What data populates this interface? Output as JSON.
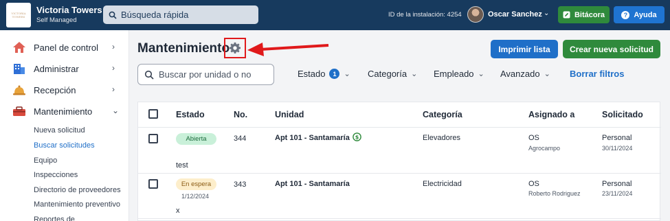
{
  "header": {
    "logo_text": "VICTORIA TOWERS",
    "brand_name": "Victoria Towers",
    "brand_sub": "Self Managed",
    "search_placeholder": "Búsqueda rápida",
    "installation_id": "ID de la instalación: 4254",
    "user_name": "Oscar Sanchez",
    "bitacora_label": "Bitácora",
    "ayuda_label": "Ayuda"
  },
  "sidebar": {
    "items": [
      {
        "label": "Panel de control",
        "chev": "›"
      },
      {
        "label": "Administrar",
        "chev": "›"
      },
      {
        "label": "Recepción",
        "chev": "›"
      },
      {
        "label": "Mantenimiento",
        "chev": "⌄"
      }
    ],
    "subitems": [
      {
        "label": "Nueva solicitud"
      },
      {
        "label": "Buscar solicitudes"
      },
      {
        "label": "Equipo"
      },
      {
        "label": "Inspecciones"
      },
      {
        "label": "Directorio de proveedores"
      },
      {
        "label": "Mantenimiento preventivo"
      },
      {
        "label": "Reportes de"
      }
    ]
  },
  "main": {
    "title": "Mantenimiento",
    "print_label": "Imprimir lista",
    "new_label": "Crear nueva solicitud",
    "search_placeholder": "Buscar por unidad o no",
    "filters": {
      "estado": "Estado",
      "estado_count": "1",
      "categoria": "Categoría",
      "empleado": "Empleado",
      "avanzado": "Avanzado",
      "clear": "Borrar filtros"
    }
  },
  "table": {
    "headers": {
      "estado": "Estado",
      "no": "No.",
      "unidad": "Unidad",
      "categoria": "Categoría",
      "asignado": "Asignado a",
      "solicitado": "Solicitado"
    },
    "rows": [
      {
        "status": "Abierta",
        "number": "344",
        "unit": "Apt 101 - Santamaría",
        "unit_icon": "dollar-circle-icon",
        "category": "Elevadores",
        "assignee_initials": "OS",
        "assignee_company": "Agrocampo",
        "requested_type": "Personal",
        "requested_date": "30/11/2024",
        "note": "test"
      },
      {
        "status": "En espera",
        "status_date": "1/12/2024",
        "number": "343",
        "unit": "Apt 101 - Santamaría",
        "category": "Electricidad",
        "assignee_initials": "OS",
        "assignee_company": "Roberto Rodriguez",
        "requested_type": "Personal",
        "requested_date": "23/11/2024",
        "note": "x"
      }
    ]
  },
  "colors": {
    "topbar": "#173a5e",
    "accent_blue": "#1f6fc8",
    "accent_green": "#2f8a3c",
    "annotation_red": "#e0191b",
    "status_open_bg": "#c9f0d9",
    "status_wait_bg": "#fdeecb"
  }
}
